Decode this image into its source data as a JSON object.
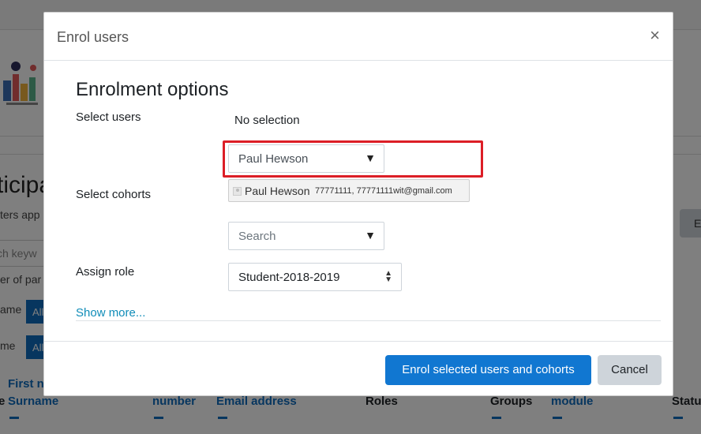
{
  "background": {
    "title": "ticipa",
    "subtitle": "ters app",
    "search_placeholder": "ch keyw",
    "filter_row1": "er of par",
    "filter_row2": "ame",
    "filter_row3": "me",
    "pill1": "All",
    "pill2": "All",
    "right_button": "E",
    "columns": {
      "first_name": "First n",
      "surname": "Surname",
      "number": "number",
      "email": "Email address",
      "roles": "Roles",
      "groups": "Groups",
      "module": "module",
      "status": "Status"
    },
    "col_prefix": "e"
  },
  "modal": {
    "title": "Enrol users",
    "close_glyph": "×",
    "section_title": "Enrolment options",
    "select_users_label": "Select users",
    "no_selection": "No selection",
    "user_select_value": "Paul Hewson",
    "dropdown_arrow": "▼",
    "selected_user": {
      "name": "Paul Hewson",
      "details": "77771111, 77771111wit@gmail.com"
    },
    "select_cohorts_label": "Select cohorts",
    "cohort_search_placeholder": "Search",
    "assign_role_label": "Assign role",
    "assign_role_value": "Student-2018-2019",
    "show_more": "Show more...",
    "enrol_button": "Enrol selected users and cohorts",
    "cancel_button": "Cancel"
  }
}
